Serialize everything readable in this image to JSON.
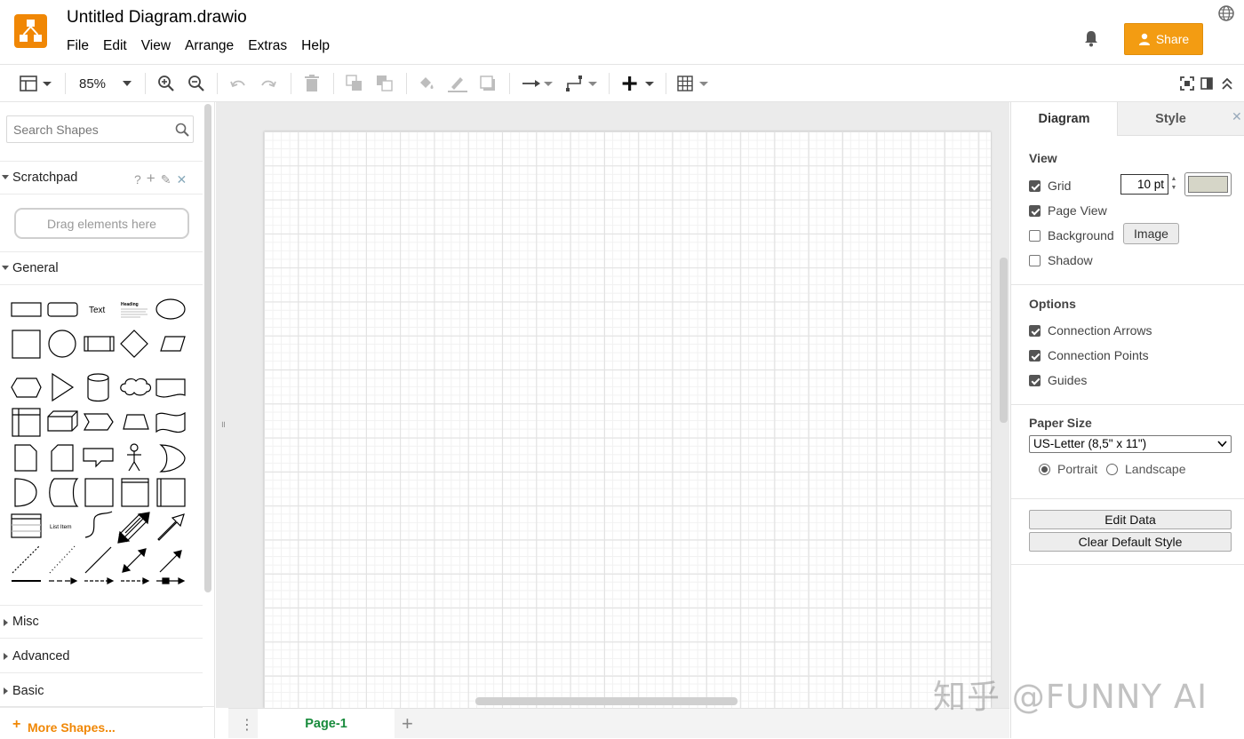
{
  "app": {
    "title": "Untitled Diagram.drawio",
    "brand_color": "#f08705",
    "menu": [
      "File",
      "Edit",
      "View",
      "Arrange",
      "Extras",
      "Help"
    ],
    "share_label": "Share"
  },
  "toolbar": {
    "zoom": "85%",
    "icons": [
      "format-panel-icon",
      "zoom-in-icon",
      "zoom-out-icon",
      "undo-icon",
      "redo-icon",
      "delete-icon",
      "to-front-icon",
      "to-back-icon",
      "fill-color-icon",
      "line-color-icon",
      "shadow-icon",
      "connection-icon",
      "waypoints-icon",
      "insert-icon",
      "table-icon",
      "fullscreen-icon",
      "format-toggle-icon",
      "collapse-icon"
    ]
  },
  "sidebar": {
    "search_placeholder": "Search Shapes",
    "scratchpad": {
      "title": "Scratchpad",
      "drop_hint": "Drag elements here"
    },
    "general": {
      "title": "General",
      "text_shape": "Text",
      "heading_shape": "Heading",
      "list_item_shape": "List Item"
    },
    "collapsed_sections": [
      "Misc",
      "Advanced",
      "Basic"
    ],
    "more_shapes": "More Shapes..."
  },
  "pages": {
    "tabs": [
      "Page-1"
    ],
    "active_color": "#188b3c"
  },
  "format_panel": {
    "tabs": [
      "Diagram",
      "Style"
    ],
    "view": {
      "title": "View",
      "grid": {
        "label": "Grid",
        "checked": true,
        "size": "10 pt",
        "color": "#d6d6c8"
      },
      "page_view": {
        "label": "Page View",
        "checked": true
      },
      "background": {
        "label": "Background",
        "checked": false,
        "button": "Image"
      },
      "shadow": {
        "label": "Shadow",
        "checked": false
      }
    },
    "options": {
      "title": "Options",
      "connection_arrows": {
        "label": "Connection Arrows",
        "checked": true
      },
      "connection_points": {
        "label": "Connection Points",
        "checked": true
      },
      "guides": {
        "label": "Guides",
        "checked": true
      }
    },
    "paper": {
      "title": "Paper Size",
      "selected": "US-Letter (8,5\" x 11\")",
      "portrait": "Portrait",
      "landscape": "Landscape",
      "orientation": "portrait"
    },
    "buttons": {
      "edit_data": "Edit Data",
      "clear_default_style": "Clear Default Style"
    }
  },
  "watermark": "知乎 @FUNNY AI"
}
